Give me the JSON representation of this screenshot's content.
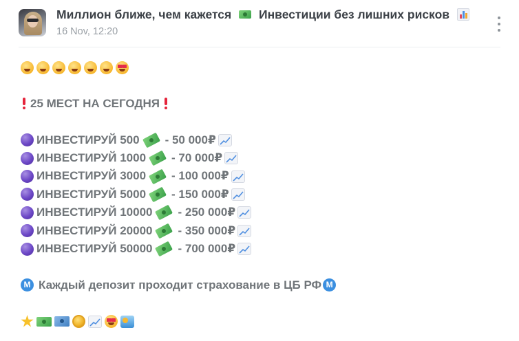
{
  "post": {
    "channel_title": "Миллион ближе, чем кажется",
    "channel_title_suffix": "Инвестиции без лишних рисков",
    "date": "16 Nov, 12:20"
  },
  "message": {
    "emoji_row_top": [
      "grinning-face-icon",
      "smiling-face-icon",
      "beaming-face-icon",
      "woozy-face-icon",
      "laughing-face-icon",
      "savoring-face-icon",
      "heart-eyes-icon"
    ],
    "headline": "25 МЕСТ НА СЕГОДНЯ",
    "offers": [
      {
        "text": "ИНВЕСТИРУЙ 500",
        "return": "- 50 000₽"
      },
      {
        "text": "ИНВЕСТИРУЙ 1000",
        "return": "- 70 000₽"
      },
      {
        "text": "ИНВЕСТИРУЙ 3000",
        "return": "- 100 000₽"
      },
      {
        "text": "ИНВЕСТИРУЙ 5000",
        "return": "- 150 000₽"
      },
      {
        "text": "ИНВЕСТИРУЙ 10000",
        "return": "- 250 000₽"
      },
      {
        "text": "ИНВЕСТИРУЙ 20000",
        "return": "- 350 000₽"
      },
      {
        "text": "ИНВЕСТИРУЙ 50000",
        "return": "- 700 000₽"
      }
    ],
    "insurance_note": "Каждый депозит проходит страхование в ЦБ РФ",
    "metro_glyph": "M",
    "emoji_row_bottom": [
      "star-icon",
      "dollar-banknote-icon",
      "yen-banknote-icon",
      "coin-icon",
      "chart-increasing-icon",
      "star-struck-icon",
      "water-wave-icon"
    ]
  },
  "colors": {
    "title_text": "#3c4147",
    "body_text": "#707579",
    "accent_red": "#e5243b",
    "accent_purple": "#6c47c6",
    "metro_blue": "#3b8fe0"
  }
}
